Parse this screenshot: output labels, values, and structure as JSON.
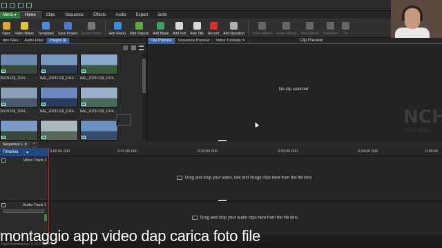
{
  "quick_access": [
    "save-icon",
    "undo-icon",
    "redo-icon",
    "help-icon"
  ],
  "menu_label": "Menu",
  "tabs": [
    "Home",
    "Clips",
    "Sequence",
    "Effects",
    "Audio",
    "Export",
    "Suite"
  ],
  "ribbon": [
    {
      "label": "Open",
      "icon": "open-folder-icon",
      "color": "#d9a830",
      "dim": false
    },
    {
      "label": "Video Maker",
      "icon": "wand-icon",
      "color": "#e0c040",
      "dim": false
    },
    {
      "label": "Templates",
      "icon": "templates-icon",
      "color": "#4a8ad8",
      "dim": false
    },
    {
      "label": "Save Project",
      "icon": "save-icon",
      "color": "#4a7ac8",
      "dim": false
    },
    {
      "label": "Export Video",
      "icon": "export-video-icon",
      "color": "#777777",
      "dim": true
    },
    {
      "label": "Add File(s)",
      "icon": "add-file-icon",
      "color": "#3a8ae0",
      "dim": false
    },
    {
      "label": "Add Objects",
      "icon": "add-objects-icon",
      "color": "#5aaa40",
      "dim": false
    },
    {
      "label": "Add Blank",
      "icon": "add-blank-icon",
      "color": "#3aa060",
      "dim": false
    },
    {
      "label": "Add Text",
      "icon": "text-icon",
      "color": "#d8d8d8",
      "dim": false
    },
    {
      "label": "Add Title",
      "icon": "title-icon",
      "color": "#d8d8d8",
      "dim": false
    },
    {
      "label": "Record",
      "icon": "record-icon",
      "color": "#d03030",
      "dim": false
    },
    {
      "label": "Add Narration",
      "icon": "microphone-icon",
      "color": "#b0b0b0",
      "dim": false
    },
    {
      "label": "Video Effects",
      "icon": "video-effects-icon",
      "color": "#666666",
      "dim": true
    },
    {
      "label": "Audio Effects",
      "icon": "audio-effects-icon",
      "color": "#666666",
      "dim": true
    },
    {
      "label": "Text Effects",
      "icon": "text-effects-icon",
      "color": "#666666",
      "dim": true
    },
    {
      "label": "Transition",
      "icon": "transition-icon",
      "color": "#666666",
      "dim": true
    },
    {
      "label": "Tre",
      "icon": "tree-icon",
      "color": "#666666",
      "dim": true
    }
  ],
  "bin_tabs": [
    "deo Files",
    "Audio Files",
    "Images"
  ],
  "bin_active": "Images",
  "thumbnails": [
    {
      "label": "20231228_1023...",
      "sky": "#6a8ab0",
      "ground": "#3a4a3a"
    },
    {
      "label": "IMG_20231228_1023...",
      "sky": "#7a9ac0",
      "ground": "#2a3a4a"
    },
    {
      "label": "IMG_20231228_1023...",
      "sky": "#8aaad0",
      "ground": "#3a5a3a"
    },
    {
      "label": "20231228_1024...",
      "sky": "#8aa0b8",
      "ground": "#4a5a6a"
    },
    {
      "label": "IMG_20231228_1024...",
      "sky": "#6a8ac0",
      "ground": "#2a3a5a"
    },
    {
      "label": "IMG_20231228_1024...",
      "sky": "#9ab0c8",
      "ground": "#4a6a5a"
    },
    {
      "label": "",
      "sky": "#7a9ac8",
      "ground": "#3a4a3a"
    },
    {
      "label": "",
      "sky": "#aab8c0",
      "ground": "#5a6a5a"
    },
    {
      "label": "",
      "sky": "#6a90c0",
      "ground": "#3a4a6a"
    }
  ],
  "preview_tabs": [
    "Clip Preview",
    "Sequence Preview",
    "Video Tutorials"
  ],
  "preview_title": "Clip Preview",
  "no_clip": "No clip selected",
  "watermark": "NCH",
  "watermark_sub": "NCH Softw",
  "sequence_tab": "Sequence 1",
  "timeline_label": "Timeline",
  "ruler_ticks": [
    "0:00:00.000",
    "0:01:00.000",
    "0:02:00.000",
    "0:03:00.000",
    "0:04:00.000",
    "0:05:00"
  ],
  "video_track": "Video Track 1",
  "video_hint": "Drag and drop your video, text and image clips here from the file bins",
  "audio_track": "Audio Track 1",
  "audio_hint": "Drag and drop your audio clips here from the file bins",
  "caption": "montaggio app video dap  carica foto file",
  "status": "Pad Professional v 8.70 © NCH"
}
